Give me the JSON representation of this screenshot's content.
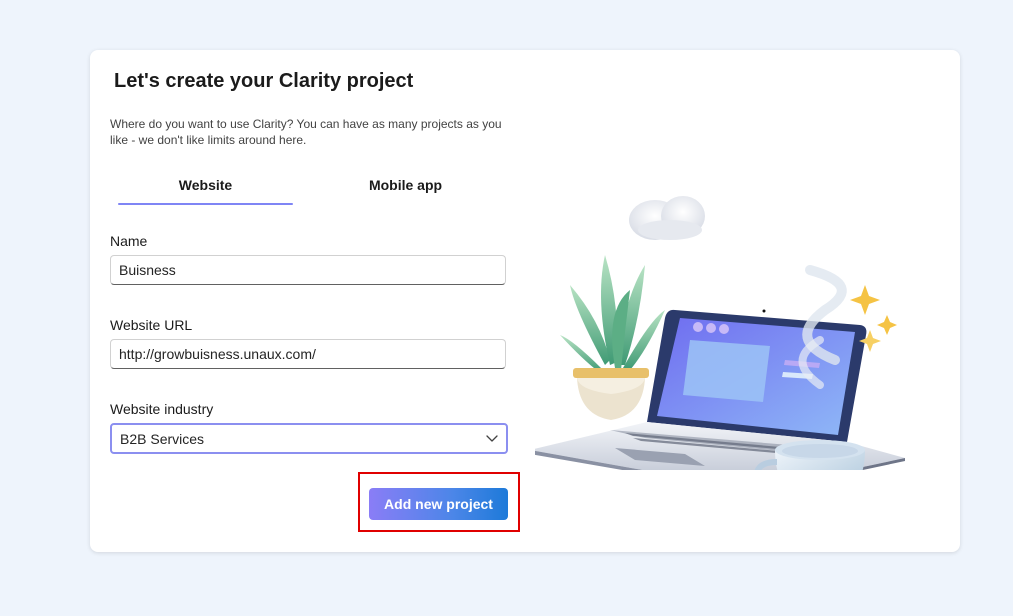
{
  "page": {
    "title": "Let's create your Clarity project",
    "subtitle": "Where do you want to use Clarity? You can have as many projects as you like - we don't like limits around here."
  },
  "tabs": [
    {
      "label": "Website",
      "active": true
    },
    {
      "label": "Mobile app",
      "active": false
    }
  ],
  "form": {
    "name": {
      "label": "Name",
      "value": "Buisness"
    },
    "url": {
      "label": "Website URL",
      "value": "http://growbuisness.unaux.com/"
    },
    "industry": {
      "label": "Website industry",
      "value": "B2B Services"
    },
    "submit_label": "Add new project"
  },
  "icons": {
    "dropdown": "chevron-down-icon",
    "illustration": "laptop-plant-coffee-illustration"
  },
  "colors": {
    "background": "#eef4fc",
    "accent": "#7f85f5",
    "button_start": "#8a7df6",
    "button_end": "#1d7ad9",
    "highlight": "#e00000"
  }
}
